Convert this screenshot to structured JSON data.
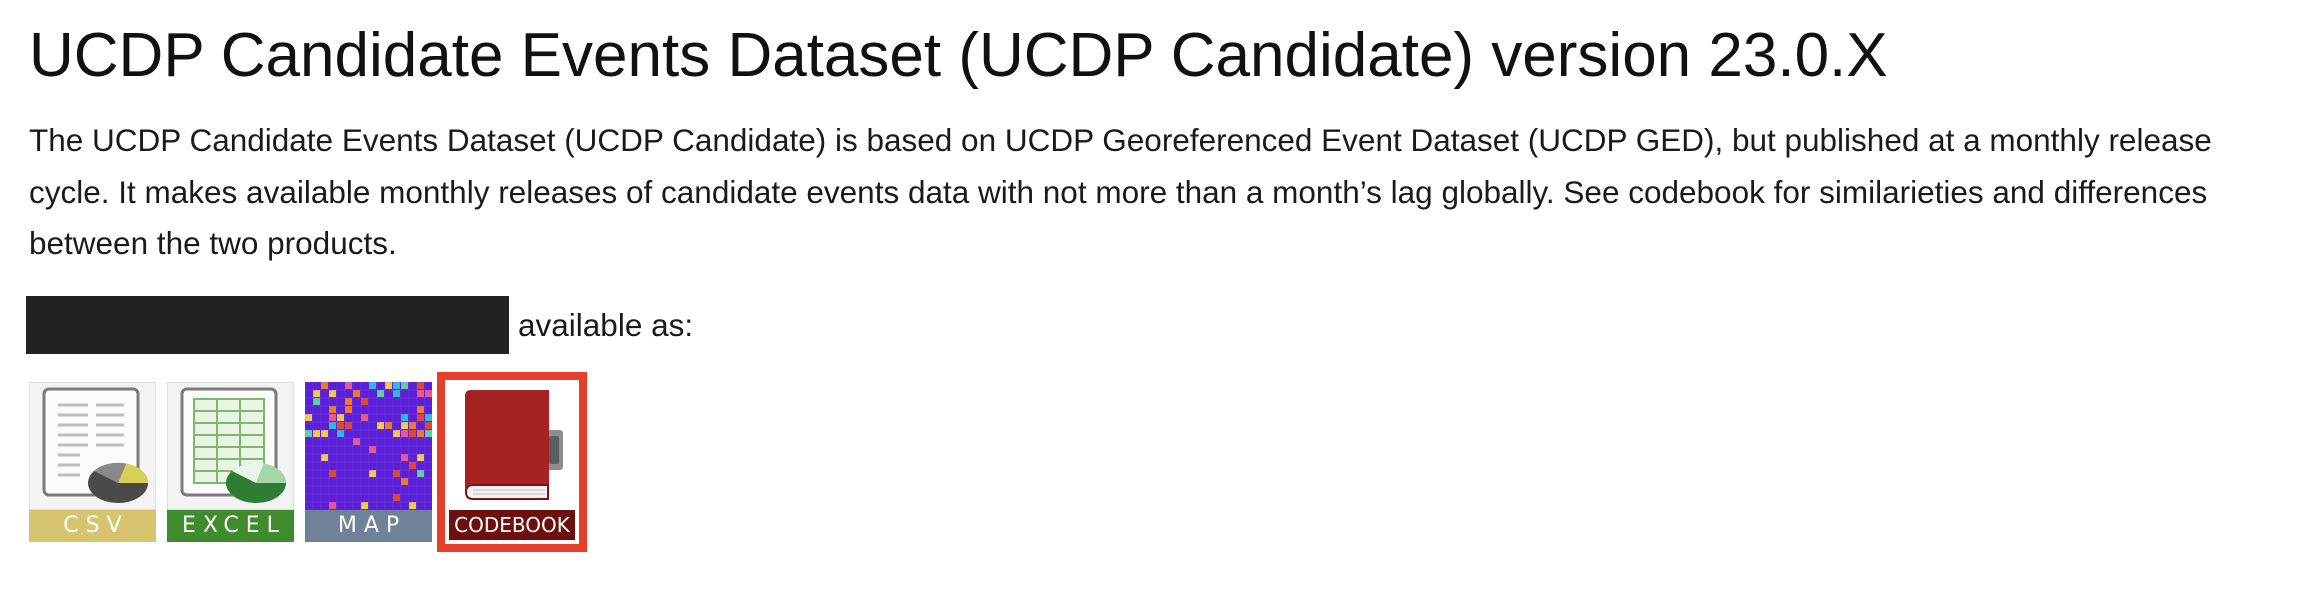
{
  "page": {
    "title": "UCDP Candidate Events Dataset (UCDP Candidate) version 23.0.X",
    "description": "The UCDP Candidate Events Dataset (UCDP Candidate) is based on UCDP Georeferenced Event Dataset (UCDP GED), but published at a monthly release cycle. It makes available monthly releases of candidate events data with not more than a month’s lag globally. See codebook for similarieties and differences between the two products.",
    "available_as": "available as:"
  },
  "downloads": [
    {
      "label": "CSV",
      "icon": "csv-file-icon",
      "color": "#d6c46e"
    },
    {
      "label": "EXCEL",
      "icon": "excel-file-icon",
      "color": "#3f8b2e"
    },
    {
      "label": "MAP",
      "icon": "map-icon",
      "color": "#6f8299"
    },
    {
      "label": "CODEBOOK",
      "icon": "codebook-book-icon",
      "color": "#6e0f0f",
      "highlighted": true,
      "highlight_color": "#e5412a"
    }
  ]
}
